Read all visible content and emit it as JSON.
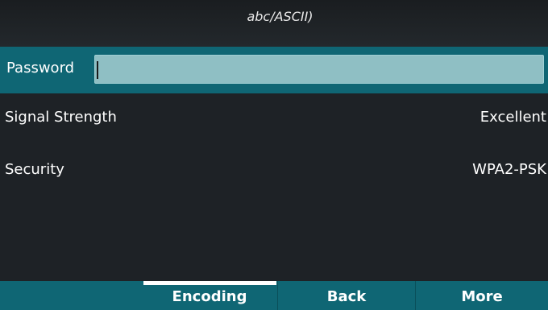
{
  "header": {
    "input_mode": "abc/ASCII)"
  },
  "password_row": {
    "label": "Password",
    "value": ""
  },
  "info": {
    "signal_strength": {
      "label": "Signal Strength",
      "value": "Excellent"
    },
    "security": {
      "label": "Security",
      "value": "WPA2-PSK"
    }
  },
  "softkeys": {
    "slot1": "",
    "encoding": "Encoding",
    "back": "Back",
    "more": "More"
  },
  "colors": {
    "background": "#1e2226",
    "accent_teal": "#0f6674",
    "input_fill": "#8fbfc4",
    "text": "#ffffff"
  }
}
